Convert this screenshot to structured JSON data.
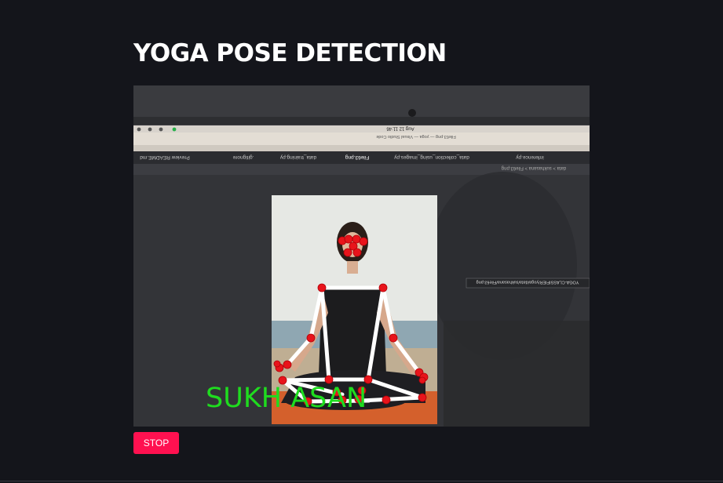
{
  "page": {
    "title": "YOGA POSE DETECTION",
    "stop_label": "STOP"
  },
  "video": {
    "pose_label": "SUKH ASAN",
    "screen": {
      "menubar_clock": "Aug 12 11:46",
      "window_title": "File63.png — yoga — Visual Studio Code",
      "tabs": [
        "Preview README.md",
        ".gitignore",
        "data_training.py",
        "File63.png",
        "data_collection_using_images.py",
        "inference.py"
      ],
      "breadcrumb": "data > sukhasana > File63.png",
      "path_tooltip": "YOGA-CLASSIFIER/yoga/data/sukhasana/File63.png"
    },
    "colors": {
      "keypoint": "#e8141b",
      "skeleton": "#ffffff",
      "label": "#1fdc1f"
    }
  }
}
